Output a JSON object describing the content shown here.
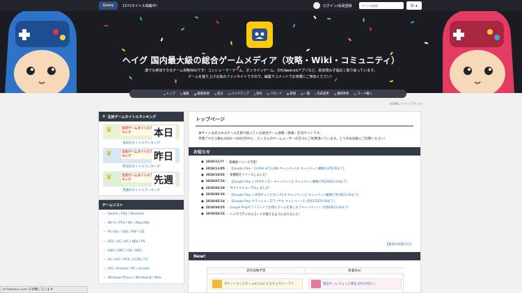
{
  "header": {
    "logo_text": "Gamy",
    "title_count": "1572タイトル掲載中！",
    "login_label": "ログイン/会員登録",
    "search_placeholder": "サイト内検索",
    "google_label": "G"
  },
  "hero": {
    "title": "ヘイグ 国内最大級の総合ゲームメディア（攻略・Wiki・コミュニティ）",
    "desc_line1": "誰でも参加できるゲーム攻略Wikiです！コンシューマーゲーム、オンラインゲーム、iOS/Androidアプリなど、新旧問わず幅広く取り扱っています。",
    "desc_line2": "ゲームを盛り上げる為のファンサイトですので、編集やコメントでお気軽にご参加ください！"
  },
  "nav": {
    "items": [
      {
        "icon": "home",
        "label": "トップ"
      },
      {
        "icon": "pencil",
        "label": "編集"
      },
      {
        "icon": "page",
        "label": "履歴新規"
      },
      {
        "icon": "diff",
        "label": "差分"
      },
      {
        "icon": "backup",
        "label": "バックアップ"
      },
      {
        "icon": "file",
        "label": "添付"
      },
      {
        "icon": "reload",
        "label": "リロード"
      },
      {
        "icon": "new",
        "label": "新規"
      },
      {
        "icon": "list",
        "label": "一覧"
      },
      {
        "icon": "search",
        "label": "名前変更"
      },
      {
        "icon": "clock",
        "label": "最終更新"
      },
      {
        "icon": "cart",
        "label": "コード購入"
      }
    ]
  },
  "breadcrumb": "HOME > トップページ",
  "sidebar": {
    "ranking_title": "注目ゲームタイトルランキング",
    "banners": [
      {
        "small": "注目ゲームタイトルランキング",
        "big": "本日",
        "color": "#e9f1d6",
        "link": "本日のタイトルランキング"
      },
      {
        "small": "注目ゲームタイトルランキング",
        "big": "昨日",
        "color": "#d7e7f4",
        "link": "昨日のタイトルランキング"
      },
      {
        "small": "注目ゲームタイトルランキング",
        "big": "先週",
        "color": "#dff0d9",
        "link": "先週のタイトルランキング"
      }
    ],
    "gamelist_title": "ゲームリスト",
    "gamelist": [
      "Switch / PS4 / XboxOne",
      "Wii U / PS3 / Wii / Xbox360",
      "PS Vita / 3DS / PSP / DS",
      "PS2 / GC / DC / N64 / PS",
      "GBA / GBC / GB / WSC",
      "SS / SFC / PCE / FCDS / FC",
      "iOS / Android / PC / Arcade",
      "Windows Phone / Windows8 / Web"
    ]
  },
  "main": {
    "top_heading": "トップページ",
    "intro1": "本サイトはあらゆるゲームを取り扱っている総合ゲーム攻略・情報・交流サイトです。",
    "intro2": "月間アクセス数も2000〜3000万PVと、たくさんのゲームユーザーの方々にご利用頂いています。どうぞお気軽にご利用ください！",
    "news_heading": "お知らせ",
    "news": [
      {
        "date": "2018/11/??",
        "text": "新機能リリース予定！",
        "linked": false
      },
      {
        "date": "2018/11/05",
        "text": "【Google Play – CLASH of CLANS キャンペーン】キャンペーン概要(12月2日まで)",
        "linked": true
      },
      {
        "date": "2018/10/02",
        "text": "新機能をリリースしました！",
        "linked": false
      },
      {
        "date": "2018/07/16",
        "text": "【Google Play × FIFAサッカー キャンペーン】キャンペーン概要(7月29日23:59まで)",
        "linked": true
      },
      {
        "date": "2018/06/18",
        "text": "サイトリニューアルしました！",
        "linked": false
      },
      {
        "date": "2018/06/18",
        "text": "【Google Play × BFBチャンピオンズ2.0 キャンペーン】キャンペーン概要(7月1日23:59まで)",
        "linked": true
      },
      {
        "date": "2018/05/14",
        "text": "【Google Play クラッシュ・ロワイヤル キャンペーン】(5月27日23:59まで)",
        "linked": true
      },
      {
        "date": "2018/04/25",
        "text": "Google Playギフトコードでお得にゲームを楽しもうキャンペーン！(5月6日23:59まで)",
        "linked": true
      },
      {
        "date": "2018/04/16",
        "text": "ヘイグでデジタルコードが買えるようになりました！",
        "linked": false
      }
    ],
    "news_past": "【過去のお知らせ】",
    "new_heading": "New!",
    "col1_head": "新作攻略予定",
    "col2_head": "新着Wiki",
    "col1_item": "ポケットモンスター Let's Go! ピカチュウ/イーブイ",
    "col2_item": "我出ゲーム ちょっと我出 お内が見たい"
  },
  "status": "trr.tobooiis.com を待機しています"
}
